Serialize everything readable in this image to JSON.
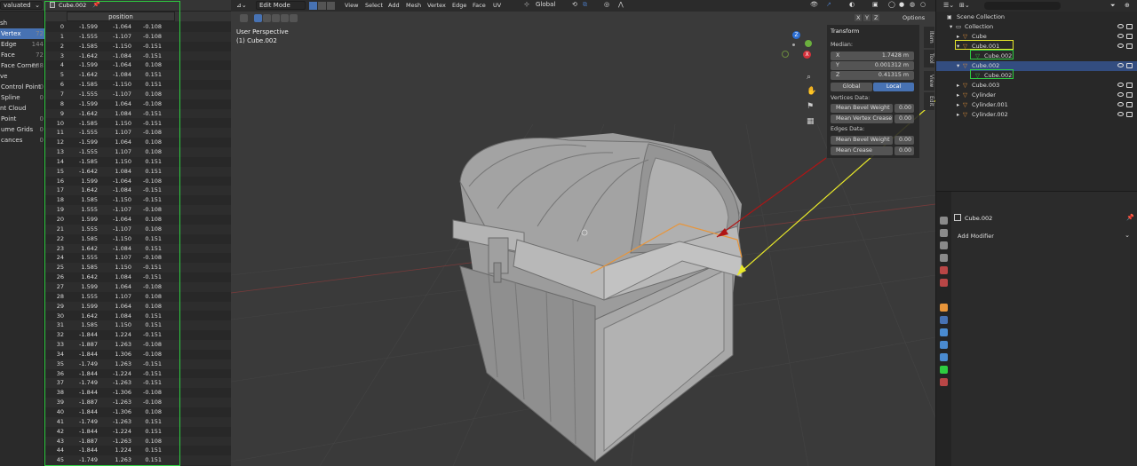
{
  "spreadsheet": {
    "mode_dropdown": "valuated",
    "object_name": "Cube.002",
    "column_header": "position",
    "domains": [
      {
        "label": "sh",
        "count": ""
      },
      {
        "label": "Vertex",
        "count": "72"
      },
      {
        "label": "Edge",
        "count": "144"
      },
      {
        "label": "Face",
        "count": "72"
      },
      {
        "label": "Face Corner",
        "count": "288"
      },
      {
        "label": "ve",
        "count": ""
      },
      {
        "label": "Control Point",
        "count": "0"
      },
      {
        "label": "Spline",
        "count": "0"
      },
      {
        "label": "nt Cloud",
        "count": ""
      },
      {
        "label": "Point",
        "count": "0"
      },
      {
        "label": "ume Grids",
        "count": "0"
      },
      {
        "label": "cances",
        "count": "0"
      }
    ],
    "rows": [
      [
        "0",
        "-1.599",
        "-1.064",
        "-0.108"
      ],
      [
        "1",
        "-1.555",
        "-1.107",
        "-0.108"
      ],
      [
        "2",
        "-1.585",
        "-1.150",
        "-0.151"
      ],
      [
        "3",
        "-1.642",
        "-1.084",
        "-0.151"
      ],
      [
        "4",
        "-1.599",
        "-1.064",
        "0.108"
      ],
      [
        "5",
        "-1.642",
        "-1.084",
        "0.151"
      ],
      [
        "6",
        "-1.585",
        "-1.150",
        "0.151"
      ],
      [
        "7",
        "-1.555",
        "-1.107",
        "0.108"
      ],
      [
        "8",
        "-1.599",
        "1.064",
        "-0.108"
      ],
      [
        "9",
        "-1.642",
        "1.084",
        "-0.151"
      ],
      [
        "10",
        "-1.585",
        "1.150",
        "-0.151"
      ],
      [
        "11",
        "-1.555",
        "1.107",
        "-0.108"
      ],
      [
        "12",
        "-1.599",
        "1.064",
        "0.108"
      ],
      [
        "13",
        "-1.555",
        "1.107",
        "0.108"
      ],
      [
        "14",
        "-1.585",
        "1.150",
        "0.151"
      ],
      [
        "15",
        "-1.642",
        "1.084",
        "0.151"
      ],
      [
        "16",
        "1.599",
        "-1.064",
        "-0.108"
      ],
      [
        "17",
        "1.642",
        "-1.084",
        "-0.151"
      ],
      [
        "18",
        "1.585",
        "-1.150",
        "-0.151"
      ],
      [
        "19",
        "1.555",
        "-1.107",
        "-0.108"
      ],
      [
        "20",
        "1.599",
        "-1.064",
        "0.108"
      ],
      [
        "21",
        "1.555",
        "-1.107",
        "0.108"
      ],
      [
        "22",
        "1.585",
        "-1.150",
        "0.151"
      ],
      [
        "23",
        "1.642",
        "-1.084",
        "0.151"
      ],
      [
        "24",
        "1.555",
        "1.107",
        "-0.108"
      ],
      [
        "25",
        "1.585",
        "1.150",
        "-0.151"
      ],
      [
        "26",
        "1.642",
        "1.084",
        "-0.151"
      ],
      [
        "27",
        "1.599",
        "1.064",
        "-0.108"
      ],
      [
        "28",
        "1.555",
        "1.107",
        "0.108"
      ],
      [
        "29",
        "1.599",
        "1.064",
        "0.108"
      ],
      [
        "30",
        "1.642",
        "1.084",
        "0.151"
      ],
      [
        "31",
        "1.585",
        "1.150",
        "0.151"
      ],
      [
        "32",
        "-1.844",
        "1.224",
        "-0.151"
      ],
      [
        "33",
        "-1.887",
        "1.263",
        "-0.108"
      ],
      [
        "34",
        "-1.844",
        "1.306",
        "-0.108"
      ],
      [
        "35",
        "-1.749",
        "1.263",
        "-0.151"
      ],
      [
        "36",
        "-1.844",
        "-1.224",
        "-0.151"
      ],
      [
        "37",
        "-1.749",
        "-1.263",
        "-0.151"
      ],
      [
        "38",
        "-1.844",
        "-1.306",
        "-0.108"
      ],
      [
        "39",
        "-1.887",
        "-1.263",
        "-0.108"
      ],
      [
        "40",
        "-1.844",
        "-1.306",
        "0.108"
      ],
      [
        "41",
        "-1.749",
        "-1.263",
        "0.151"
      ],
      [
        "42",
        "-1.844",
        "-1.224",
        "0.151"
      ],
      [
        "43",
        "-1.887",
        "-1.263",
        "0.108"
      ],
      [
        "44",
        "-1.844",
        "1.224",
        "0.151"
      ],
      [
        "45",
        "-1.749",
        "1.263",
        "0.151"
      ]
    ]
  },
  "viewport": {
    "mode": "Edit Mode",
    "menus": [
      "View",
      "Select",
      "Add",
      "Mesh",
      "Vertex",
      "Edge",
      "Face",
      "UV"
    ],
    "orientation": "Global",
    "perspective": "User Perspective",
    "object_label": "(1) Cube.002",
    "axes": [
      "X",
      "Y",
      "Z"
    ],
    "options": "Options",
    "side_tabs": [
      "Item",
      "Tool",
      "View",
      "Edit"
    ],
    "gizmo": {
      "x": "X",
      "y": "Y",
      "z": "Z"
    }
  },
  "transform_panel": {
    "title": "Transform",
    "median_label": "Median:",
    "x_label": "X",
    "x_value": "1.7428 m",
    "y_label": "Y",
    "y_value": "0.001312 m",
    "z_label": "Z",
    "z_value": "0.41315 m",
    "global_btn": "Global",
    "local_btn": "Local",
    "vertices_data": "Vertices Data:",
    "mean_bevel_weight_v": "Mean Bevel Weight",
    "mbw_v_value": "0.00",
    "mean_vertex_crease": "Mean Vertex Crease",
    "mvc_value": "0.00",
    "edges_data": "Edges Data:",
    "mean_bevel_weight_e": "Mean Bevel Weight",
    "mbw_e_value": "0.00",
    "mean_crease": "Mean Crease",
    "mc_value": "0.00"
  },
  "outliner": {
    "root": "Scene Collection",
    "items": [
      {
        "label": "Collection",
        "kind": "collection"
      },
      {
        "label": "Cube",
        "kind": "mesh"
      },
      {
        "label": "Cube.001",
        "kind": "mesh"
      },
      {
        "label": "Cube.002",
        "kind": "meshdata"
      },
      {
        "label": "Cube.002",
        "kind": "mesh"
      },
      {
        "label": "Cube.002",
        "kind": "meshdata"
      },
      {
        "label": "Cube.003",
        "kind": "mesh"
      },
      {
        "label": "Cylinder",
        "kind": "mesh"
      },
      {
        "label": "Cylinder.001",
        "kind": "mesh"
      },
      {
        "label": "Cylinder.002",
        "kind": "mesh"
      }
    ]
  },
  "properties": {
    "object_name": "Cube.002",
    "add_modifier": "Add Modifier"
  },
  "colors": {
    "accent": "#4772b3",
    "annotation_green": "#2ecc40",
    "annotation_yellow": "#e8e82a",
    "annotation_red": "#b01515",
    "orange": "#e8953a"
  }
}
